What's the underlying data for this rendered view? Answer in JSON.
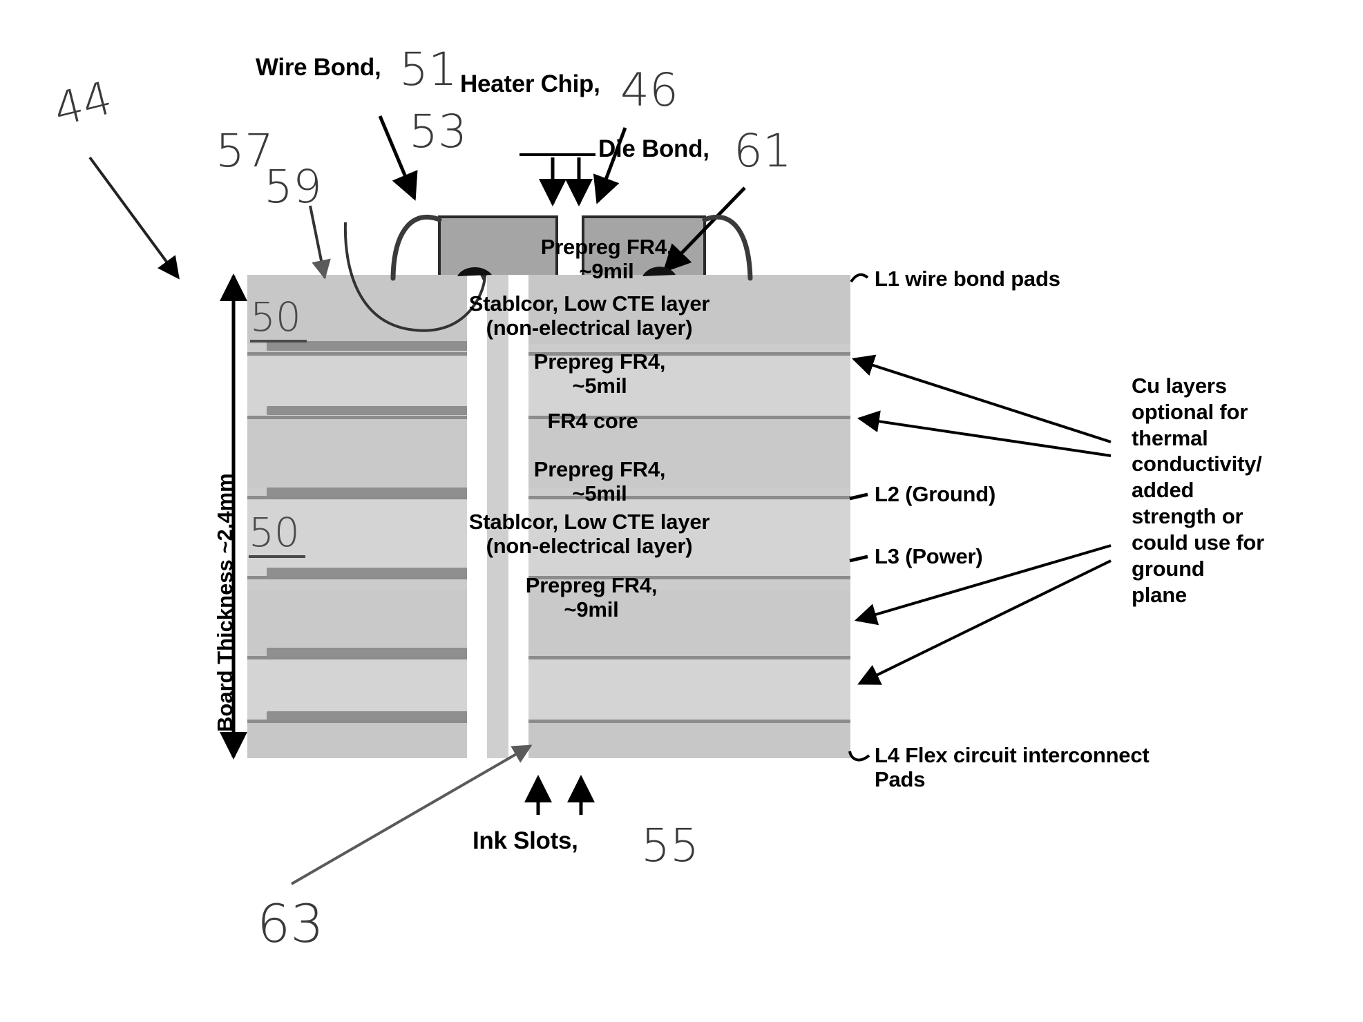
{
  "figure": {
    "reference_numerals": {
      "assembly": "44",
      "wire_bond": "51",
      "heater_chip": "46",
      "ink_slot_callout": "53",
      "solder_mask_57": "57",
      "pad_59": "59",
      "cu_pad_50_upper": "50",
      "cu_pad_50_lower": "50",
      "die_bond": "61",
      "ink_slots": "55",
      "bottom_pad_63": "63"
    },
    "callouts": {
      "wire_bond": "Wire Bond,",
      "heater_chip": "Heater Chip,",
      "die_bond": "Die Bond,",
      "ink_slots": "Ink Slots,"
    },
    "dimension_label": "Board Thickness ~2.4mm",
    "layer_labels": [
      {
        "id": "prepreg-top",
        "text": "Prepreg FR4,\n~9mil"
      },
      {
        "id": "stablcor-top",
        "text": "Stablcor, Low CTE layer\n(non-electrical layer)"
      },
      {
        "id": "prepreg-upper-mid",
        "text": "Prepreg FR4,\n~5mil"
      },
      {
        "id": "fr4-core",
        "text": "FR4 core"
      },
      {
        "id": "prepreg-lower-mid",
        "text": "Prepreg FR4,\n~5mil"
      },
      {
        "id": "stablcor-bottom",
        "text": "Stablcor, Low CTE layer\n(non-electrical layer)"
      },
      {
        "id": "prepreg-bottom",
        "text": "Prepreg FR4,\n~9mil"
      }
    ],
    "edge_labels": {
      "l1": "L1 wire bond pads",
      "l2": "L2 (Ground)",
      "l3": "L3 (Power)",
      "l4": "L4 Flex circuit interconnect\nPads"
    },
    "note_cu_layers": "Cu layers\noptional for\nthermal\nconductivity/\nadded\nstrength or\ncould use for\nground\nplane"
  },
  "colors": {
    "ink": "#000000",
    "board_fill": "#c9c9c9",
    "board_fill_light": "#d6d6d6",
    "copper": "#9a9a9a",
    "chip_fill": "#a8a8a8",
    "handwritten": "#3a3a3a"
  }
}
